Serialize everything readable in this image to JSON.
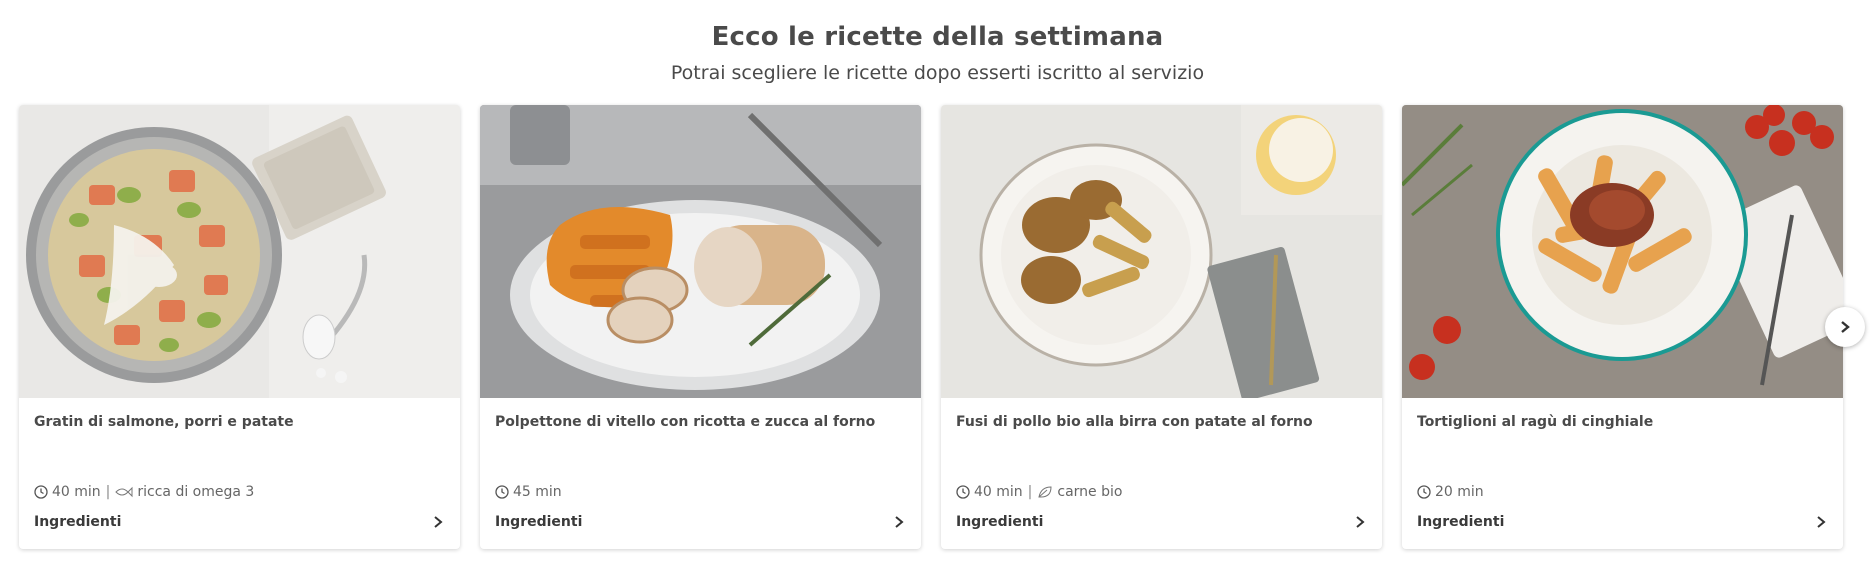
{
  "section": {
    "title": "Ecco le ricette della settimana",
    "subtitle": "Potrai scegliere le ricette dopo esserti iscritto al servizio"
  },
  "recipes": [
    {
      "title": "Gratin di salmone, porri e patate",
      "time": "40 min",
      "separator": "|",
      "tag": "ricca di omega 3",
      "tag_icon": "fish-icon",
      "ingredients_label": "Ingredienti"
    },
    {
      "title": "Polpettone di vitello con ricotta e zucca al forno",
      "time": "45 min",
      "ingredients_label": "Ingredienti"
    },
    {
      "title": "Fusi di pollo bio alla birra con patate al forno",
      "time": "40 min",
      "separator": "|",
      "tag": "carne bio",
      "tag_icon": "leaf-icon",
      "ingredients_label": "Ingredienti"
    },
    {
      "title": "Tortiglioni al ragù di cinghiale",
      "time": "20 min",
      "ingredients_label": "Ingredienti"
    }
  ],
  "colors": {
    "text": "#4a4a4a",
    "meta": "#666666",
    "card_bg": "#ffffff"
  },
  "icons": {
    "time": "clock-icon",
    "ingredients_expand": "chevron-right-icon",
    "carousel_next": "chevron-right-icon"
  }
}
